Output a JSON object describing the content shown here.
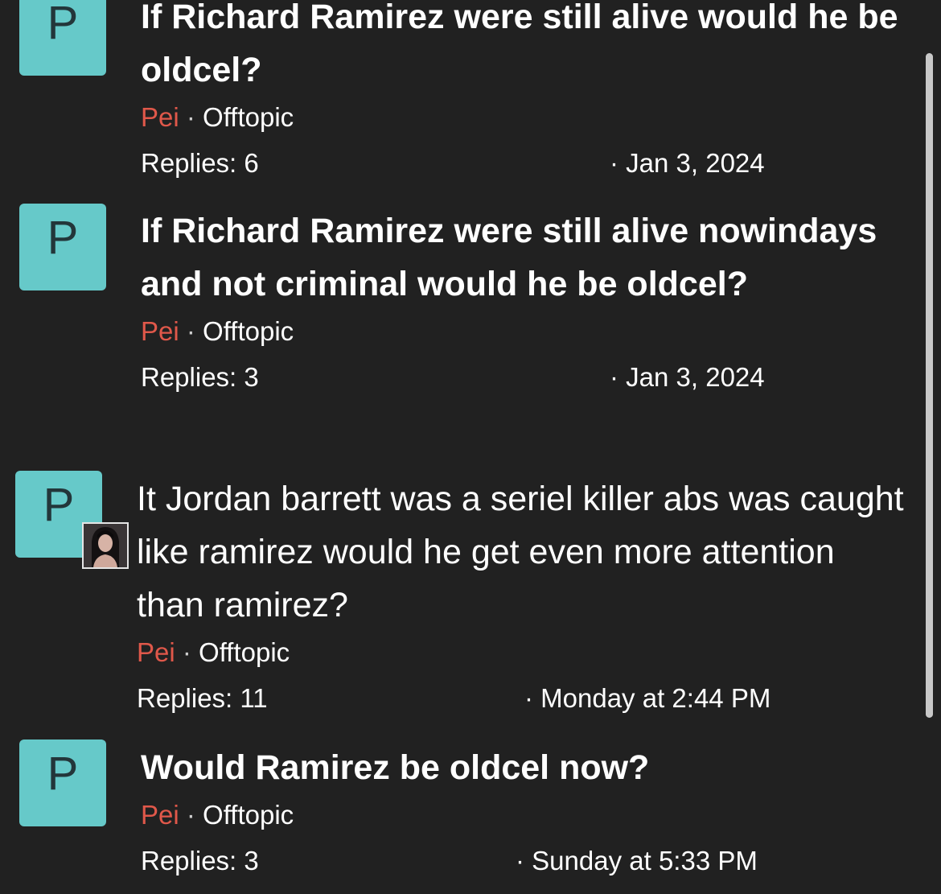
{
  "threads": [
    {
      "avatar_letter": "P",
      "title": "If Richard Ramirez were still alive would he be oldcel?",
      "author": "Pei",
      "separator": "·",
      "forum": "Offtopic",
      "replies": "Replies: 6",
      "date": "· Jan 3, 2024"
    },
    {
      "avatar_letter": "P",
      "title": "If Richard Ramirez were still alive nowindays and not criminal would he be oldcel?",
      "author": "Pei",
      "separator": "·",
      "forum": "Offtopic",
      "replies": "Replies: 3",
      "date": "· Jan 3, 2024"
    },
    {
      "avatar_letter": "P",
      "title": "It Jordan barrett was a seriel killer abs was caught like ramirez would he get even more attention than ramirez?",
      "author": "Pei",
      "separator": "·",
      "forum": "Offtopic",
      "replies": "Replies: 11",
      "date": "· Monday at 2:44 PM"
    },
    {
      "avatar_letter": "P",
      "title": "Would Ramirez be oldcel now?",
      "author": "Pei",
      "separator": "·",
      "forum": "Offtopic",
      "replies": "Replies: 3",
      "date": "· Sunday at 5:33 PM"
    }
  ],
  "colors": {
    "background": "#212121",
    "avatar_bg": "#66c9c9",
    "author": "#e0584a",
    "text": "#ffffff"
  }
}
